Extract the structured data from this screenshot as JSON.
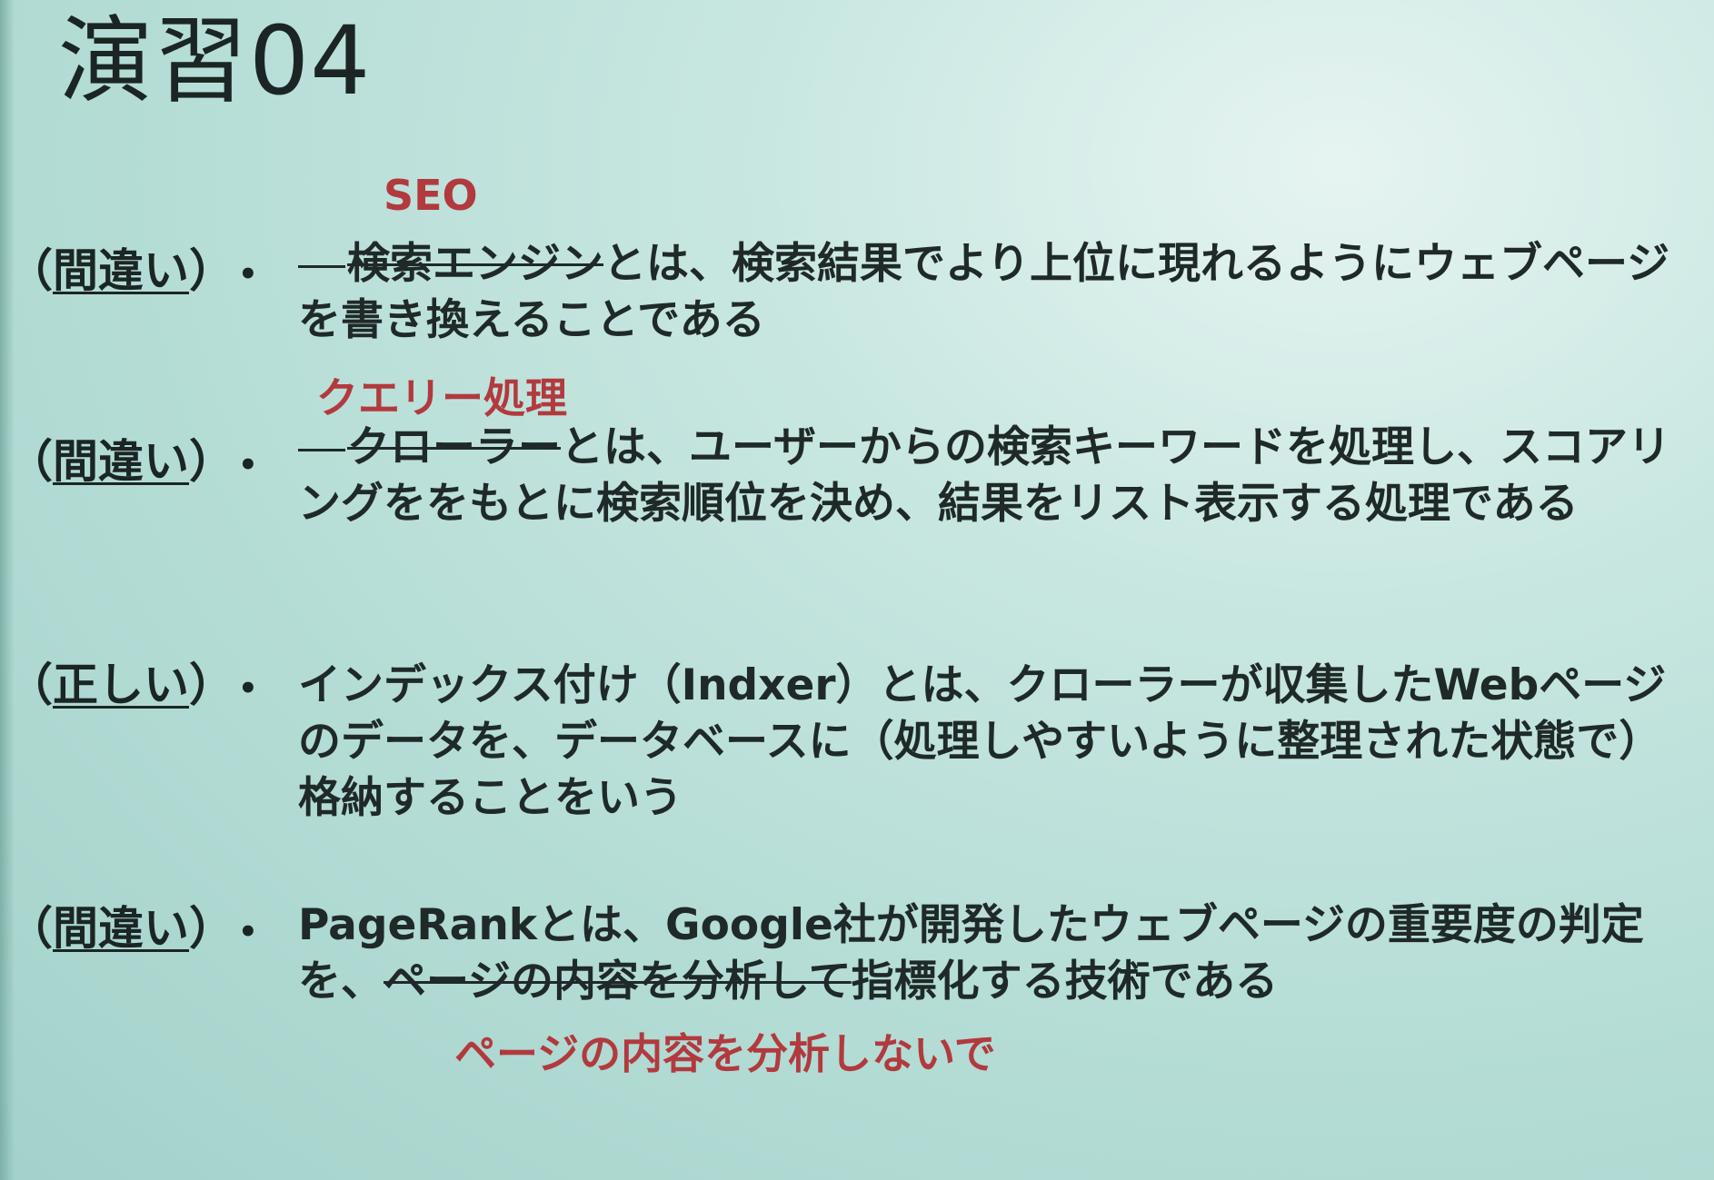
{
  "slide": {
    "title": "演習04"
  },
  "items": [
    {
      "verdict_open": "（",
      "verdict_word": "間違い",
      "verdict_close": "）",
      "bullet": "•",
      "correction": "SEO",
      "struck": "検索エンジン",
      "text": "とは、検索結果でより上位に現れるようにウェブページを書き換えることである"
    },
    {
      "verdict_open": "（",
      "verdict_word": "間違い",
      "verdict_close": "）",
      "bullet": "•",
      "correction": "クエリー処理",
      "struck": "クローラー",
      "text": "とは、ユーザーからの検索キーワードを処理し、スコアリングををもとに検索順位を決め、結果をリスト表示する処理である"
    },
    {
      "verdict_open": "（",
      "verdict_word": "正しい",
      "verdict_close": "）",
      "bullet": "•",
      "text": "インデックス付け（Indxer）とは、クローラーが収集したWebページのデータを、データベースに（処理しやすいように整理された状態で）格納することをいう"
    },
    {
      "verdict_open": "（",
      "verdict_word": "間違い",
      "verdict_close": "）",
      "bullet": "•",
      "text_before": "PageRankとは、Google社が開発したウェブページの重要度の判定を、",
      "struck": "ページの内容を分析して",
      "text_after": "指標化する技術である",
      "correction": "ページの内容を分析しないで"
    }
  ]
}
